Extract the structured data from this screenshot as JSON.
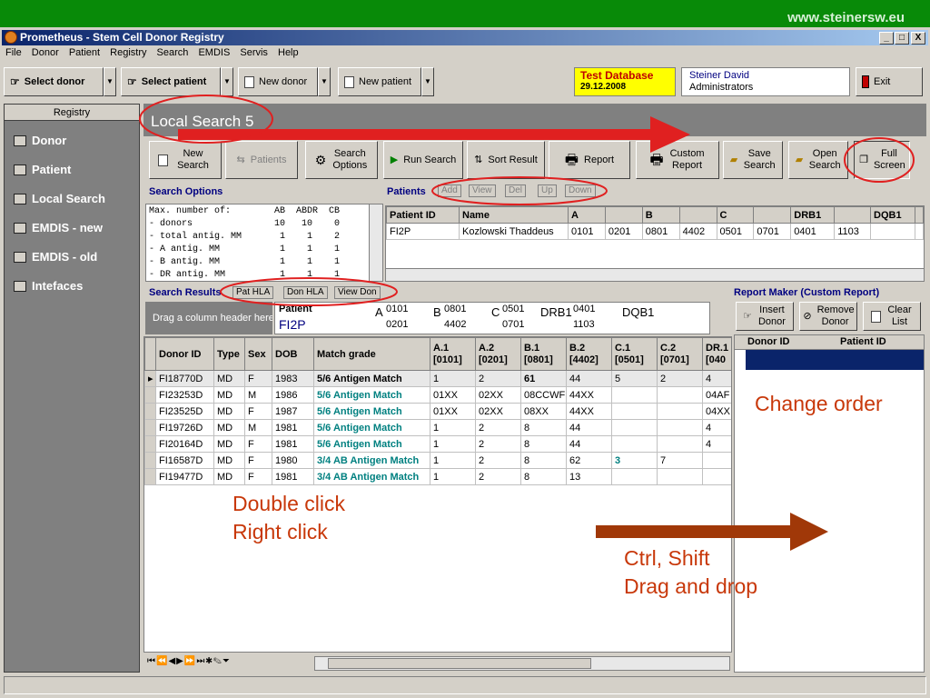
{
  "banner": {
    "url": "www.steinersw.eu"
  },
  "window": {
    "title": "Prometheus - Stem Cell Donor Registry",
    "min": "_",
    "max": "□",
    "close": "X"
  },
  "menu": [
    "File",
    "Donor",
    "Patient",
    "Registry",
    "Search",
    "EMDIS",
    "Servis",
    "Help"
  ],
  "toolbar": {
    "select_donor": "Select donor",
    "select_patient": "Select patient",
    "new_donor": "New donor",
    "new_patient": "New patient",
    "test_db": "Test Database",
    "test_date": "29.12.2008",
    "user_name": "Steiner David",
    "user_role": "Administrators",
    "exit": "Exit"
  },
  "sidebar": {
    "header": "Registry",
    "items": [
      "Donor",
      "Patient",
      "Local Search",
      "EMDIS - new",
      "EMDIS - old",
      "Intefaces"
    ]
  },
  "main": {
    "title": "Local Search 5",
    "buttons": {
      "new_search": "New Search",
      "patients": "Patients",
      "search_options": "Search Options",
      "run_search": "Run Search",
      "sort_result": "Sort Result",
      "report": "Report",
      "custom_report": "Custom Report",
      "save_search": "Save Search",
      "open_search": "Open Search",
      "full_screen": "Full Screen"
    },
    "search_options_label": "Search Options",
    "options_header": "Max. number of:        AB  ABDR  CB",
    "options_rows": [
      "- donors               10   10    0",
      "- total antig. MM       1    1    2",
      "- A antig. MM           1    1    1",
      "- B antig. MM           1    1    1",
      "- DR antig. MM          1    1    1"
    ],
    "patients_label": "Patients",
    "patient_buttons": [
      "Add",
      "View",
      "Del",
      "Up",
      "Down"
    ],
    "patients_columns": [
      "Patient ID",
      "Name",
      "A",
      "",
      "B",
      "",
      "C",
      "",
      "DRB1",
      "",
      "DQB1",
      ""
    ],
    "patients_rows": [
      [
        "FI2P",
        "Kozlowski Thaddeus",
        "0101",
        "0201",
        "0801",
        "4402",
        "0501",
        "0701",
        "0401",
        "1103",
        "",
        ""
      ]
    ],
    "search_results_label": "Search Results",
    "result_buttons": [
      "Pat HLA",
      "Don HLA",
      "View Don"
    ],
    "drag_hint": "Drag a column header here",
    "patient_info": {
      "label": "Patient",
      "id": "FI2P",
      "a_label": "A",
      "a1": "0101",
      "a2": "0201",
      "b_label": "B",
      "b1": "0801",
      "b2": "4402",
      "c_label": "C",
      "c1": "0501",
      "c2": "0701",
      "drb1_label": "DRB1",
      "drb1_1": "0401",
      "drb1_2": "1103",
      "dqb1_label": "DQB1"
    },
    "results_columns": [
      "Donor ID",
      "Type",
      "Sex",
      "DOB",
      "Match grade",
      "A.1 [0101]",
      "A.2 [0201]",
      "B.1 [0801]",
      "B.2 [4402]",
      "C.1 [0501]",
      "C.2 [0701]",
      "DR.1 [040"
    ],
    "results_rows": [
      [
        "FI18770D",
        "MD",
        "F",
        "1983",
        "5/6 Antigen Match",
        "1",
        "2",
        "61",
        "44",
        "5",
        "2",
        "4"
      ],
      [
        "FI23253D",
        "MD",
        "M",
        "1986",
        "5/6 Antigen Match",
        "01XX",
        "02XX",
        "08CCWF",
        "44XX",
        "",
        "",
        "04AF"
      ],
      [
        "FI23525D",
        "MD",
        "F",
        "1987",
        "5/6 Antigen Match",
        "01XX",
        "02XX",
        "08XX",
        "44XX",
        "",
        "",
        "04XX"
      ],
      [
        "FI19726D",
        "MD",
        "M",
        "1981",
        "5/6 Antigen Match",
        "1",
        "2",
        "8",
        "44",
        "",
        "",
        "4"
      ],
      [
        "FI20164D",
        "MD",
        "F",
        "1981",
        "5/6 Antigen Match",
        "1",
        "2",
        "8",
        "44",
        "",
        "",
        "4"
      ],
      [
        "FI16587D",
        "MD",
        "F",
        "1980",
        "3/4 AB Antigen Match",
        "1",
        "2",
        "8",
        "62",
        "3",
        "7",
        ""
      ],
      [
        "FI19477D",
        "MD",
        "F",
        "1981",
        "3/4 AB Antigen Match",
        "1",
        "2",
        "8",
        "13",
        "",
        "",
        ""
      ]
    ]
  },
  "report_maker": {
    "label": "Report Maker (Custom Report)",
    "insert": "Insert Donor",
    "remove": "Remove Donor",
    "clear": "Clear List",
    "col_donor": "Donor ID",
    "col_patient": "Patient ID"
  },
  "annotations": {
    "change_order": "Change order",
    "double_click": "Double click",
    "right_click": "Right click",
    "ctrl_shift": "Ctrl, Shift",
    "drag_drop": "Drag and drop"
  },
  "colors": {
    "banner": "#088a08",
    "annotation": "#c8380a",
    "arrow_red": "#e02020",
    "arrow_brown": "#a03808",
    "match_text": "#008080"
  }
}
